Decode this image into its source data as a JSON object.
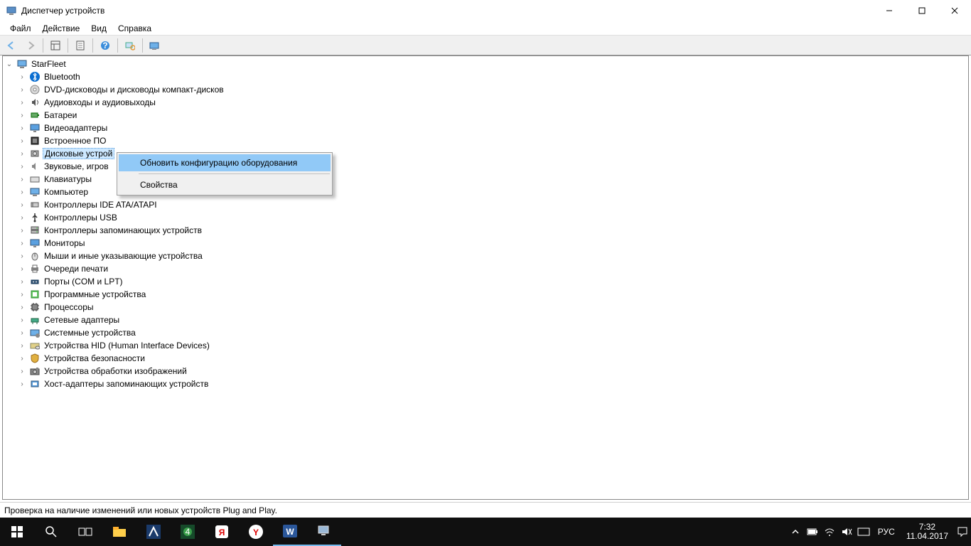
{
  "title": "Диспетчер устройств",
  "menu": {
    "file": "Файл",
    "action": "Действие",
    "view": "Вид",
    "help": "Справка"
  },
  "toolbar_icons": [
    "back",
    "forward",
    "sep",
    "table",
    "sep",
    "refresh",
    "sep",
    "help",
    "sep",
    "grid",
    "sep",
    "monitor"
  ],
  "root": "StarFleet",
  "categories": [
    {
      "label": "Bluetooth",
      "icon": "bluetooth"
    },
    {
      "label": "DVD-дисководы и дисководы компакт-дисков",
      "icon": "dvd"
    },
    {
      "label": "Аудиовходы и аудиовыходы",
      "icon": "audio"
    },
    {
      "label": "Батареи",
      "icon": "battery"
    },
    {
      "label": "Видеоадаптеры",
      "icon": "display"
    },
    {
      "label": "Встроенное ПО",
      "icon": "firmware"
    },
    {
      "label": "Дисковые устройства",
      "icon": "disk",
      "selected": true,
      "truncated": "Дисковые устрой"
    },
    {
      "label": "Звуковые, игровые и видеоустройства",
      "icon": "sound",
      "truncated": "Звуковые, игров"
    },
    {
      "label": "Клавиатуры",
      "icon": "keyboard"
    },
    {
      "label": "Компьютер",
      "icon": "computer"
    },
    {
      "label": "Контроллеры IDE ATA/ATAPI",
      "icon": "ide"
    },
    {
      "label": "Контроллеры USB",
      "icon": "usb"
    },
    {
      "label": "Контроллеры запоминающих устройств",
      "icon": "storage"
    },
    {
      "label": "Мониторы",
      "icon": "monitor"
    },
    {
      "label": "Мыши и иные указывающие устройства",
      "icon": "mouse"
    },
    {
      "label": "Очереди печати",
      "icon": "printer"
    },
    {
      "label": "Порты (COM и LPT)",
      "icon": "port"
    },
    {
      "label": "Программные устройства",
      "icon": "software"
    },
    {
      "label": "Процессоры",
      "icon": "cpu"
    },
    {
      "label": "Сетевые адаптеры",
      "icon": "network"
    },
    {
      "label": "Системные устройства",
      "icon": "system"
    },
    {
      "label": "Устройства HID (Human Interface Devices)",
      "icon": "hid"
    },
    {
      "label": "Устройства безопасности",
      "icon": "security"
    },
    {
      "label": "Устройства обработки изображений",
      "icon": "imaging"
    },
    {
      "label": "Хост-адаптеры запоминающих устройств",
      "icon": "hostadapter"
    }
  ],
  "context_menu": {
    "scan": "Обновить конфигурацию оборудования",
    "props": "Свойства"
  },
  "status": "Проверка на наличие изменений или новых устройств Plug and Play.",
  "taskbar": {
    "lang": "РУС",
    "time": "7:32",
    "date": "11.04.2017"
  }
}
